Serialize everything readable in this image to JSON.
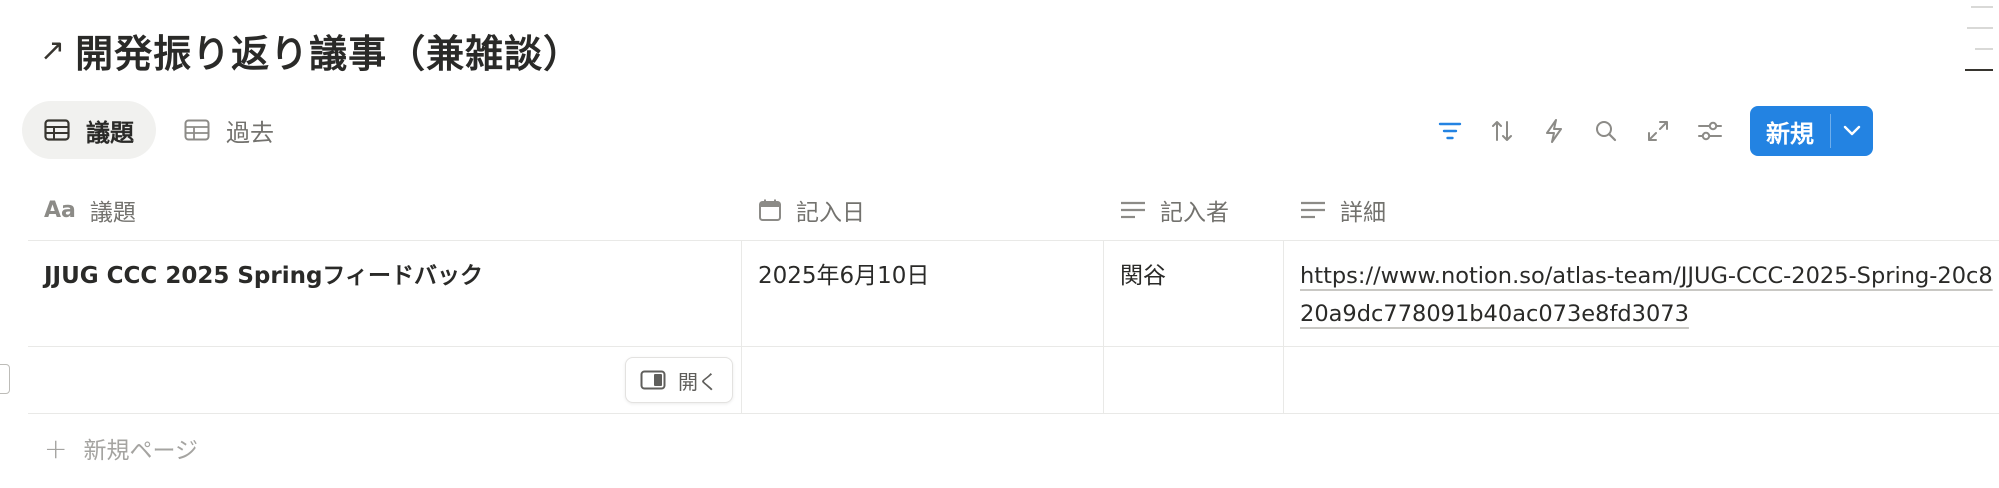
{
  "page": {
    "title_arrow": "↗",
    "title": "開発振り返り議事（兼雑談）"
  },
  "views": {
    "tabs": [
      {
        "label": "議題",
        "icon": "table-icon",
        "active": true
      },
      {
        "label": "過去",
        "icon": "table-icon",
        "active": false
      }
    ]
  },
  "toolbar": {
    "icons": [
      "filter-icon",
      "sort-icon",
      "automation-icon",
      "search-icon",
      "expand-icon",
      "settings-icon"
    ],
    "new_label": "新規",
    "accent_color": "#2383e2"
  },
  "table": {
    "columns": [
      {
        "label": "議題",
        "icon_text": "Aa",
        "icon": "title-property-icon"
      },
      {
        "label": "記入日",
        "icon": "calendar-icon"
      },
      {
        "label": "記入者",
        "icon": "text-property-icon"
      },
      {
        "label": "詳細",
        "icon": "text-property-icon"
      }
    ],
    "rows": [
      {
        "topic": "JJUG CCC 2025 Springフィードバック",
        "date": "2025年6月10日",
        "author": "関谷",
        "detail": "https://www.notion.so/atlas-team/JJUG-CCC-2025-Spring-20c820a9dc778091b40ac073e8fd3073"
      }
    ],
    "open_label": "開く",
    "add_page_label": "新規ページ"
  }
}
